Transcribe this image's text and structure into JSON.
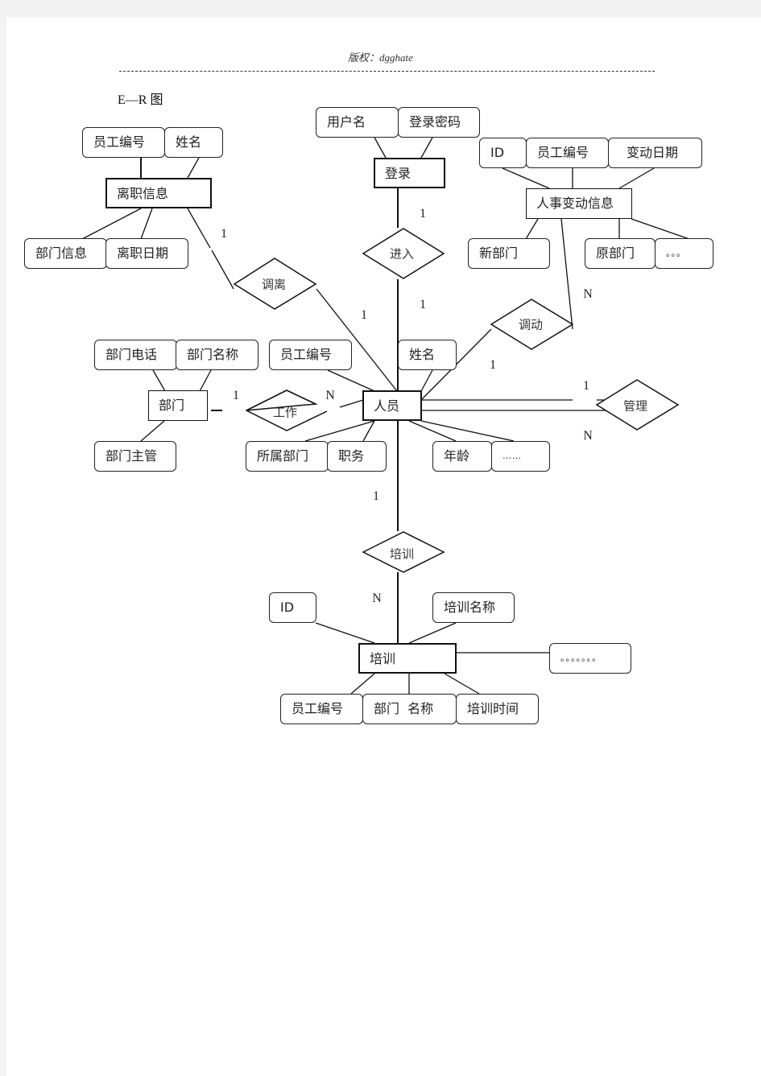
{
  "header": {
    "copyright": "版权：dgghate"
  },
  "title": "E—R 图",
  "entities": {
    "resign_info": "离职信息",
    "login": "登录",
    "personnel_change": "人事变动信息",
    "department": "部门",
    "person": "人员",
    "training": "培训"
  },
  "relationships": {
    "leave": "调离",
    "enter": "进入",
    "transfer": "调动",
    "work": "工作",
    "manage": "管理",
    "train": "培训"
  },
  "attributes": {
    "resign_emp_id": "员工编号",
    "resign_name": "姓名",
    "resign_dept_info": "部门信息",
    "resign_date": "离职日期",
    "login_username": "用户名",
    "login_password": "登录密码",
    "change_id": "ID",
    "change_emp_id": "员工编号",
    "change_date": "变动日期",
    "change_new_dept": "新部门",
    "change_old_dept": "原部门",
    "change_more": "。。。",
    "dept_phone": "部门电话",
    "dept_name": "部门名称",
    "dept_manager": "部门主管",
    "person_emp_id": "员工编号",
    "person_name": "姓名",
    "person_dept": "所属部门",
    "person_position": "职务",
    "person_age": "年龄",
    "person_more": "……",
    "train_id": "ID",
    "train_name": "培训名称",
    "train_more": "。。。。。。。",
    "train_emp_id": "员工编号",
    "train_dept_name": "部门  名称",
    "train_time": "培训时间"
  },
  "cardinalities": {
    "resign_leave": "1",
    "leave_person": "1",
    "login_enter": "1",
    "enter_person": "1",
    "transfer_change": "N",
    "person_transfer": "1",
    "dept_work": "1",
    "work_person": "N",
    "manage_one": "1",
    "manage_many": "N",
    "person_train": "1",
    "train_training": "N"
  }
}
